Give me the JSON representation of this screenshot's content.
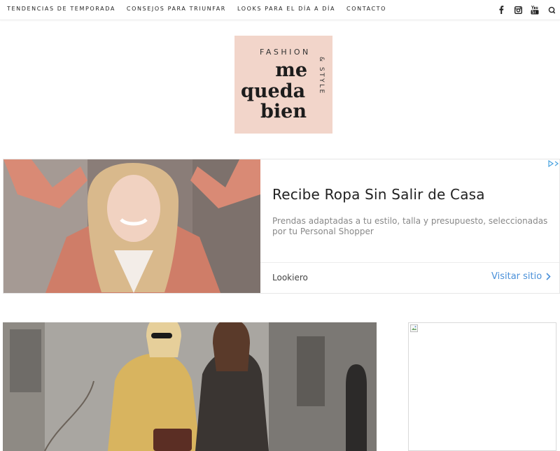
{
  "nav": {
    "items": [
      {
        "label": "TENDENCIAS DE TEMPORADA",
        "name": "nav-item-tendencias"
      },
      {
        "label": "CONSEJOS PARA TRIUNFAR",
        "name": "nav-item-consejos"
      },
      {
        "label": "LOOKS PARA EL DÍA A DÍA",
        "name": "nav-item-looks"
      },
      {
        "label": "CONTACTO",
        "name": "nav-item-contacto"
      }
    ],
    "socials": [
      "facebook-icon",
      "instagram-icon",
      "youtube-icon",
      "search-icon"
    ]
  },
  "logo": {
    "fashion": "FASHION",
    "line1": "me",
    "line2": "queda",
    "line3": "bien",
    "style": "& STYLE",
    "background": "#f2d5ca"
  },
  "ad": {
    "headline": "Recibe Ropa Sin Salir de Casa",
    "description": "Prendas adaptadas a tu estilo, talla y presupuesto, seleccionadas por tu Personal Shopper",
    "advertiser": "Lookiero",
    "cta": "Visitar sitio",
    "cta_color": "#4a90d9"
  }
}
